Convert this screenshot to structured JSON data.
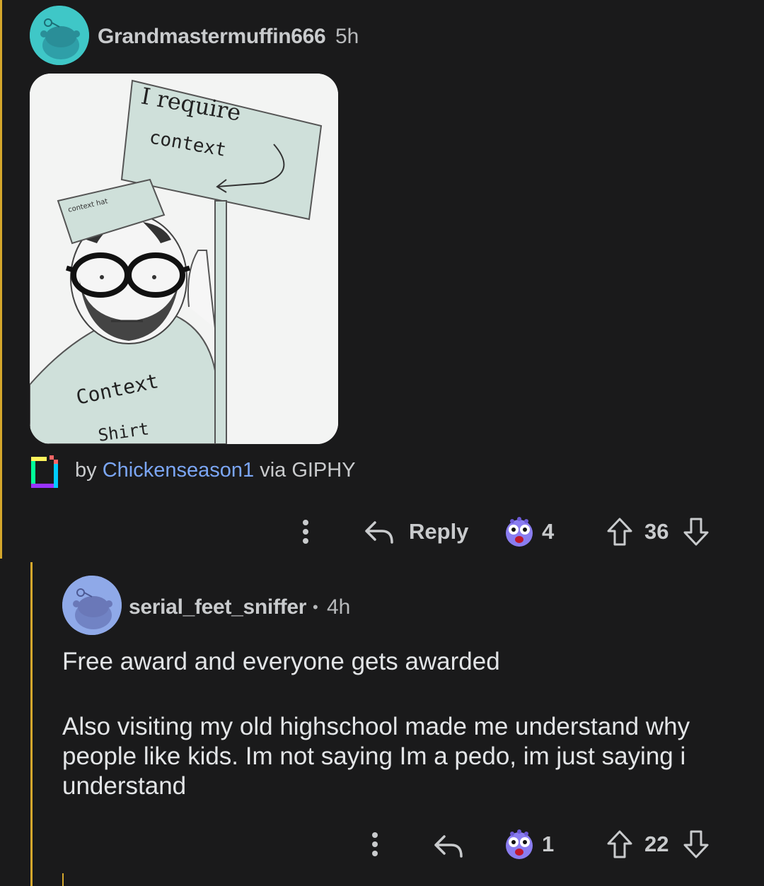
{
  "comment": {
    "username": "Grandmastermuffin666",
    "time": "5h",
    "gif": {
      "sign_text_1": "I require",
      "sign_text_2": "context",
      "hat_text": "context hat",
      "shirt_text_1": "Context",
      "shirt_text_2": "Shirt"
    },
    "giphy": {
      "prefix": "by",
      "author": "Chickenseason1",
      "suffix": "via GIPHY"
    },
    "actions": {
      "reply_label": "Reply",
      "award_count": "4",
      "score": "36"
    }
  },
  "reply": {
    "username": "serial_feet_sniffer",
    "separator": "•",
    "time": "4h",
    "paragraph_1": "Free award and everyone gets awarded",
    "paragraph_2_line_1": "Also visiting my old highschool made me understand why",
    "paragraph_2_line_2": "people like kids. Im not saying Im a pedo, im just saying i",
    "paragraph_2_line_3": "understand",
    "actions": {
      "award_count": "1",
      "score": "22"
    }
  },
  "colors": {
    "background": "#1a1a1b",
    "thread_line": "#d4a72c",
    "link": "#7ba6f5",
    "avatar_1": "#3fc7c7",
    "avatar_2": "#8fa9e8"
  }
}
